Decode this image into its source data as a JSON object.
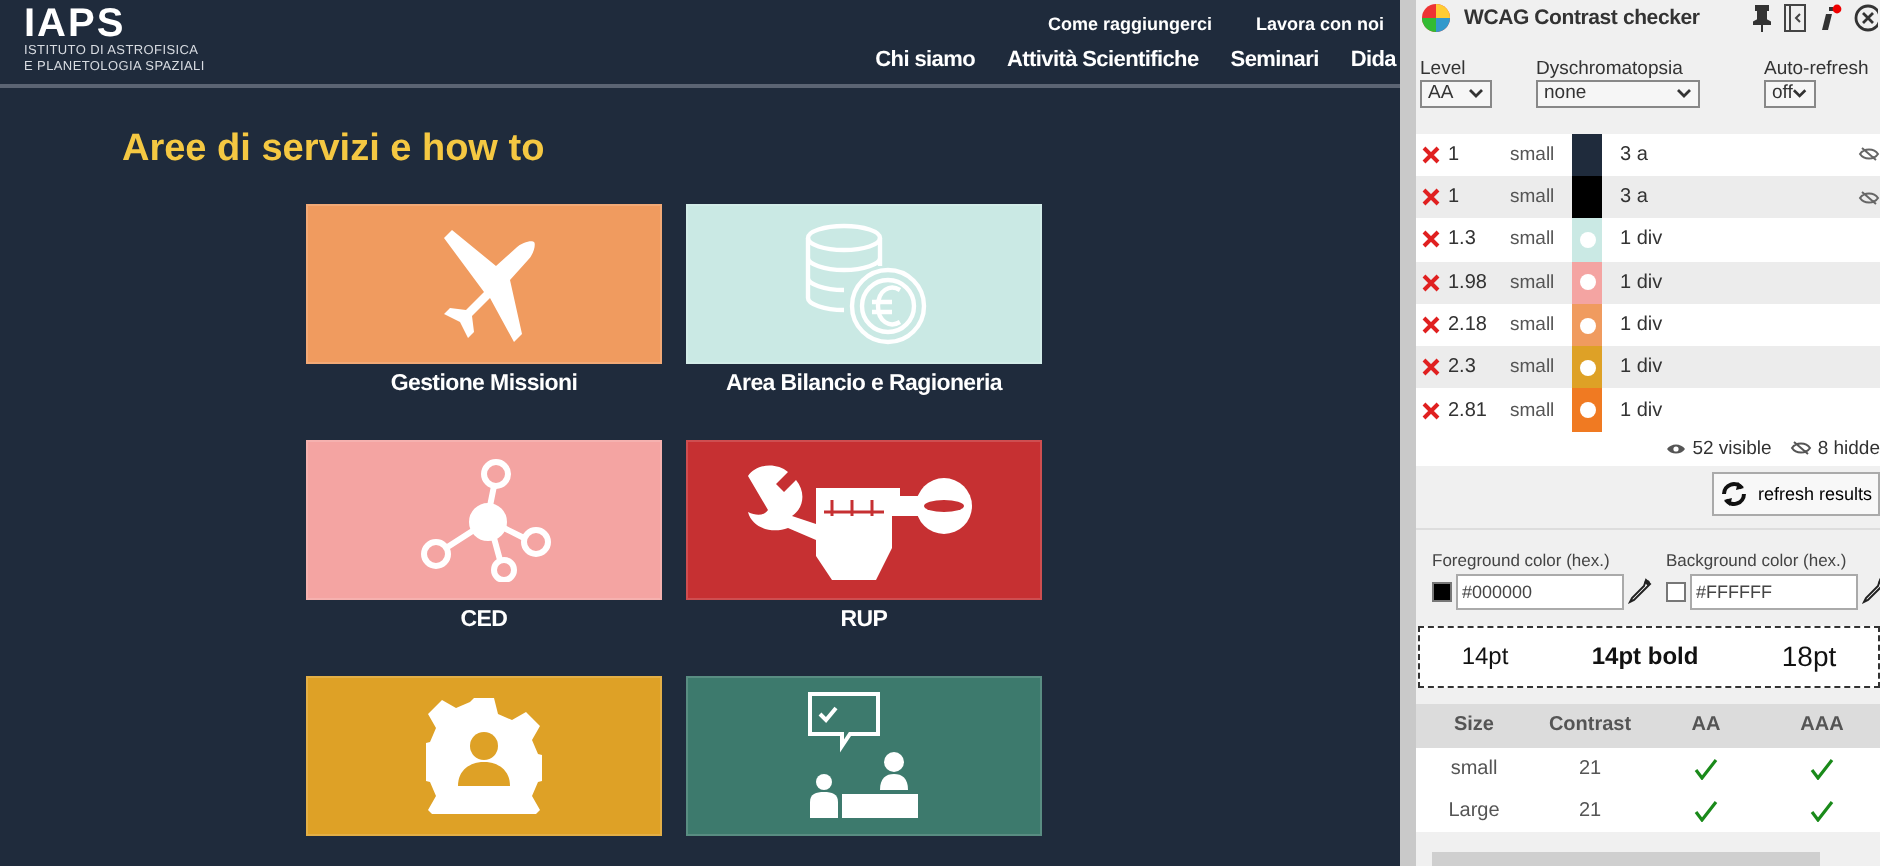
{
  "site": {
    "logo": "IAPS",
    "logo_subtitle_1": "ISTITUTO DI ASTROFISICA",
    "logo_subtitle_2": "E PLANETOLOGIA SPAZIALI",
    "top_links": [
      "Come raggiungerci",
      "Lavora con noi"
    ],
    "nav": [
      "Chi siamo",
      "Attività Scientifiche",
      "Seminari",
      "Dida"
    ],
    "heading": "Aree di servizi e how to",
    "tiles": [
      {
        "label": "Gestione Missioni",
        "kind": "plane",
        "color": "#f09b5f"
      },
      {
        "label": "Area Bilancio e Ragioneria",
        "kind": "coins",
        "color": "#cae9e4"
      },
      {
        "label": "CED",
        "kind": "network",
        "color": "#f4a4a2"
      },
      {
        "label": "RUP",
        "kind": "fist",
        "color": "#c63032"
      },
      {
        "kind": "gear",
        "color": "#dea126"
      },
      {
        "kind": "meeting",
        "color": "#3d7a6d"
      }
    ]
  },
  "checker": {
    "title": "WCAG Contrast checker",
    "controls": [
      {
        "label": "Level",
        "value": "AA"
      },
      {
        "label": "Dyschromatopsia",
        "value": "none"
      },
      {
        "label": "Auto-refresh",
        "value": "off"
      }
    ],
    "rows": [
      {
        "pass": false,
        "ratio": "1",
        "size": "small",
        "color": "#1f2b3c",
        "kind": "plain",
        "target": "3 a",
        "hidden": true
      },
      {
        "pass": false,
        "ratio": "1",
        "size": "small",
        "color": "#000000",
        "kind": "plain",
        "target": "3 a",
        "hidden": true
      },
      {
        "pass": false,
        "ratio": "1.3",
        "size": "small",
        "color": "#cae9e4",
        "kind": "dot",
        "target": "1 div",
        "hidden": false
      },
      {
        "pass": false,
        "ratio": "1.98",
        "size": "small",
        "color": "#f4a4a2",
        "kind": "dot",
        "target": "1 div",
        "hidden": false
      },
      {
        "pass": false,
        "ratio": "2.18",
        "size": "small",
        "color": "#f09b5f",
        "kind": "dot",
        "target": "1 div",
        "hidden": false
      },
      {
        "pass": false,
        "ratio": "2.3",
        "size": "small",
        "color": "#dea126",
        "kind": "dot",
        "target": "1 div",
        "hidden": false
      },
      {
        "pass": false,
        "ratio": "2.81",
        "size": "small",
        "color": "#f07a22",
        "kind": "dot",
        "target": "1 div",
        "hidden": false
      }
    ],
    "visible_count": "52 visible",
    "hidden_count": "8 hidde",
    "refresh": "refresh results",
    "foreground": {
      "label": "Foreground color (hex.)",
      "value": "#000000",
      "color": "#000000"
    },
    "background": {
      "label": "Background color (hex.)",
      "value": "#FFFFFF",
      "color": "#ffffff"
    },
    "preview": [
      "14pt",
      "14pt bold",
      "18pt"
    ],
    "results": {
      "columns": [
        "Size",
        "Contrast",
        "AA",
        "AAA"
      ],
      "rows": [
        {
          "size": "small",
          "contrast": "21",
          "aa": true,
          "aaa": true
        },
        {
          "size": "Large",
          "contrast": "21",
          "aa": true,
          "aaa": true
        }
      ]
    }
  }
}
